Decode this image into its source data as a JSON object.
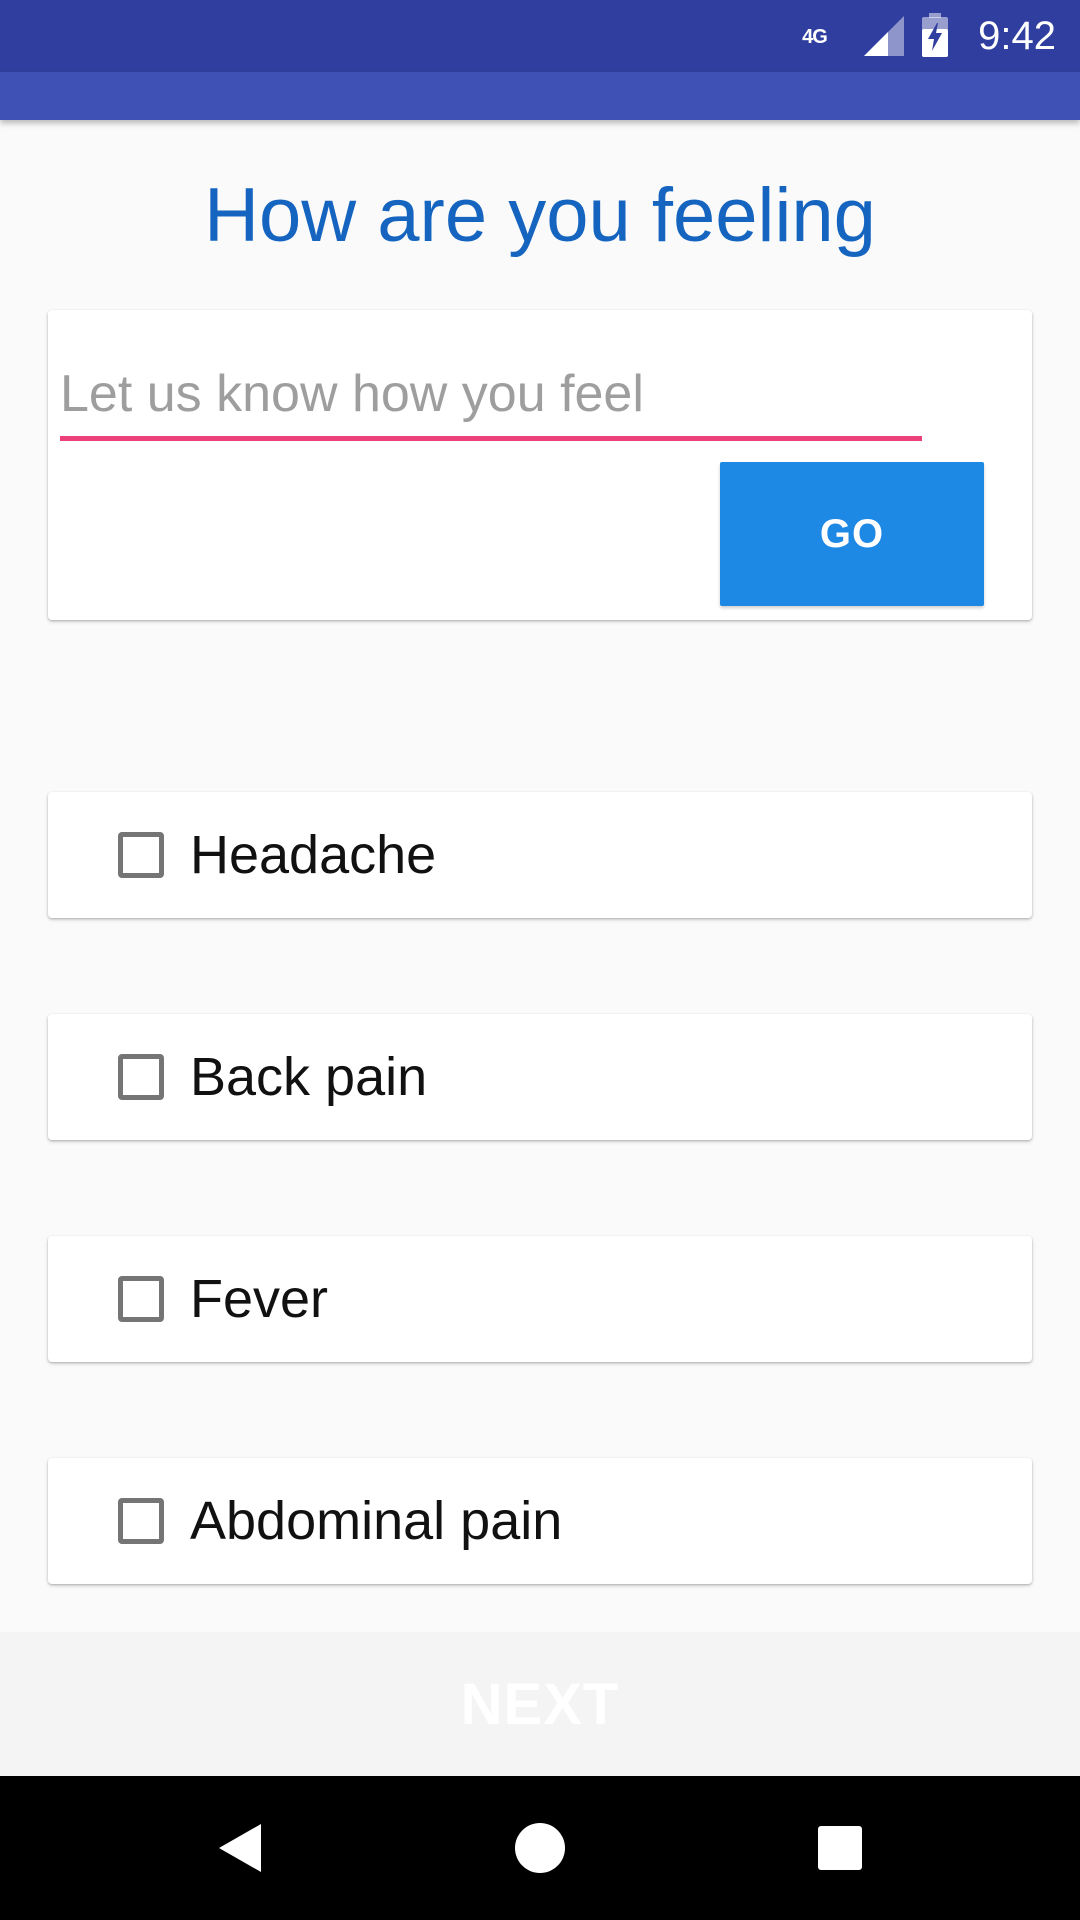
{
  "status_bar": {
    "network_type": "4G",
    "time": "9:42"
  },
  "screen": {
    "title": "How are you feeling"
  },
  "input_card": {
    "placeholder": "Let us know how you feel",
    "value": "",
    "go_label": "GO"
  },
  "symptoms": [
    {
      "label": "Headache",
      "checked": false
    },
    {
      "label": "Back pain",
      "checked": false
    },
    {
      "label": "Fever",
      "checked": false
    },
    {
      "label": "Abdominal pain",
      "checked": false
    }
  ],
  "footer": {
    "next_label": "NEXT"
  },
  "colors": {
    "status_bar": "#303f9f",
    "app_bar": "#3f51b5",
    "title": "#1565c0",
    "input_underline": "#ec407a",
    "go_button": "#1e88e5"
  },
  "icons": {
    "signal": "signal-icon",
    "battery": "battery-charging-icon",
    "back": "back-icon",
    "home": "home-icon",
    "recents": "recents-icon"
  }
}
